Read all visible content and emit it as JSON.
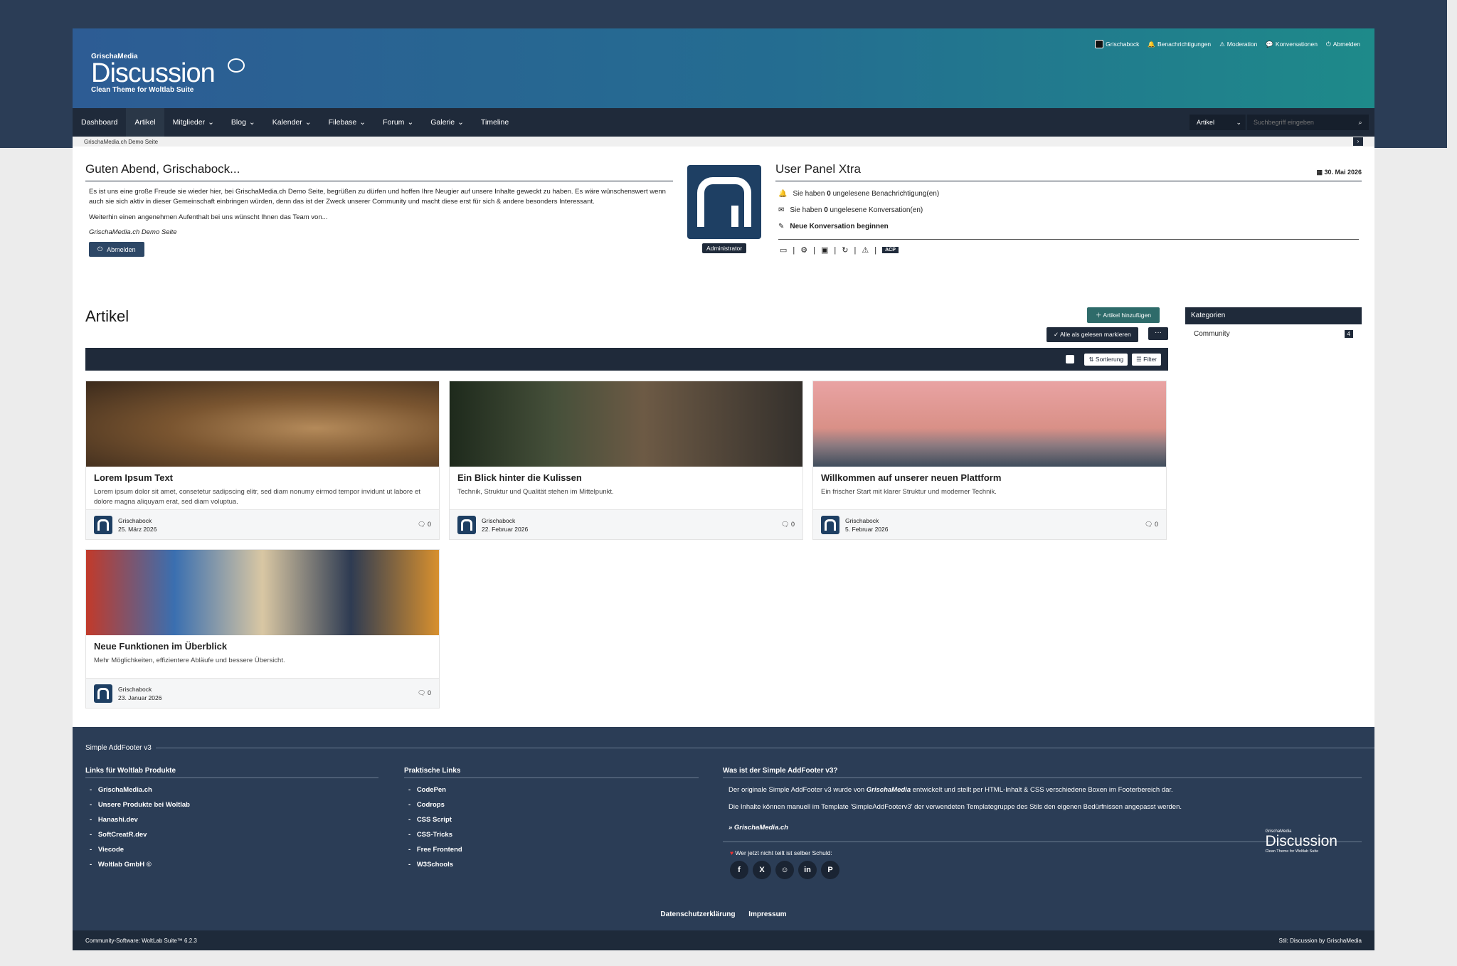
{
  "header": {
    "logo_small": "GrischaMedia",
    "logo_big": "Discussion",
    "logo_tag": "Clean Theme for Woltlab Suite",
    "userbar": [
      "Grischabock",
      "Benachrichtigungen",
      "Moderation",
      "Konversationen",
      "Abmelden"
    ]
  },
  "nav": {
    "items": [
      "Dashboard",
      "Artikel",
      "Mitglieder",
      "Blog",
      "Kalender",
      "Filebase",
      "Forum",
      "Galerie",
      "Timeline"
    ],
    "search_select": "Artikel",
    "search_placeholder": "Suchbegriff eingeben"
  },
  "breadcrumb": "GrischaMedia.ch Demo Seite",
  "welcome": {
    "title": "Guten Abend, Grischabock...",
    "text1": "Es ist uns eine große Freude sie wieder hier, bei GrischaMedia.ch Demo Seite, begrüßen zu dürfen und hoffen Ihre Neugier auf unsere Inhalte geweckt zu haben. Es wäre wünschenswert wenn auch sie sich aktiv in dieser Gemeinschaft einbringen würden, denn das ist der Zweck unserer Community und macht diese erst für sich & andere besonders Interessant.",
    "text2": "Weiterhin einen angenehmen Aufenthalt bei uns wünscht Ihnen das Team von...",
    "sign": "GrischaMedia.ch Demo Seite",
    "logout": "Abmelden"
  },
  "avatar_badge": "Administrator",
  "panel": {
    "title": "User Panel Xtra",
    "date": "30. Mai 2026",
    "notif_pre": "Sie haben ",
    "notif_count": "0",
    "notif_post": " ungelesene Benachrichtigung(en)",
    "conv_pre": "Sie haben ",
    "conv_count": "0",
    "conv_post": " ungelesene Konversation(en)",
    "new_conv": "Neue Konversation beginnen",
    "acp": "ACP"
  },
  "articles": {
    "heading": "Artikel",
    "add_button": "Artikel hinzufügen",
    "mark_read": "Alle als gelesen markieren",
    "more": "···",
    "sort": "Sortierung",
    "filter": "Filter",
    "cards": [
      {
        "title": "Lorem Ipsum Text",
        "desc": "Lorem ipsum dolor sit amet, consetetur sadipscing elitr, sed diam nonumy eirmod tempor invidunt ut labore et dolore magna aliquyam erat, sed diam voluptua.",
        "author": "Grischabock",
        "date": "25. März 2026",
        "comments": "0"
      },
      {
        "title": "Ein Blick hinter die Kulissen",
        "desc": "Technik, Struktur und Qualität stehen im Mittelpunkt.",
        "author": "Grischabock",
        "date": "22. Februar 2026",
        "comments": "0"
      },
      {
        "title": "Willkommen auf unserer neuen Plattform",
        "desc": "Ein frischer Start mit klarer Struktur und moderner Technik.",
        "author": "Grischabock",
        "date": "5. Februar 2026",
        "comments": "0"
      },
      {
        "title": "Neue Funktionen im Überblick",
        "desc": "Mehr Möglichkeiten, effizientere Abläufe und bessere Übersicht.",
        "author": "Grischabock",
        "date": "23. Januar 2026",
        "comments": "0"
      }
    ]
  },
  "sidebar": {
    "title": "Kategorien",
    "item_label": "Community",
    "item_count": "4"
  },
  "footer": {
    "title": "Simple AddFooter v3",
    "col1_title": "Links für Woltlab Produkte",
    "col1": [
      "GrischaMedia.ch",
      "Unsere Produkte bei Woltlab",
      "Hanashi.dev",
      "SoftCreatR.dev",
      "Viecode",
      "Woltlab GmbH ©"
    ],
    "col2_title": "Praktische Links",
    "col2": [
      "CodePen",
      "Codrops",
      "CSS Script",
      "CSS-Tricks",
      "Free Frontend",
      "W3Schools"
    ],
    "col3_title": "Was ist der Simple AddFooter v3?",
    "col3_p1a": "Der originale Simple AddFooter v3 wurde von ",
    "col3_p1_brand": "GrischaMedia",
    "col3_p1b": " entwickelt und stellt per HTML-Inhalt & CSS verschiedene Boxen im Footerbereich dar.",
    "col3_p2": "Die Inhalte können manuell im Template 'SimpleAddFooterv3' der verwendeten Templategruppe des Stils den eigenen Bedürfnissen angepasst werden.",
    "col3_link": "» GrischaMedia.ch",
    "share": "Wer jetzt nicht teilt ist selber Schuld:",
    "logo_small": "GrischaMedia",
    "logo_big": "Discussion",
    "logo_tag": "Clean Theme for Woltlab Suite",
    "privacy": "Datenschutzerklärung",
    "imprint": "Impressum"
  },
  "bottom": {
    "left": "Community-Software: WoltLab Suite™ 6.2.3",
    "right": "Stil: Discussion by GrischaMedia"
  }
}
